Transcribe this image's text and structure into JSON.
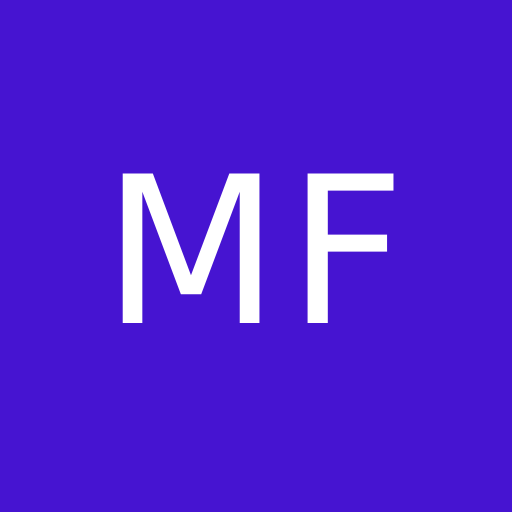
{
  "avatar": {
    "initials": "MF",
    "background_color": "#4614d1",
    "text_color": "#ffffff"
  }
}
